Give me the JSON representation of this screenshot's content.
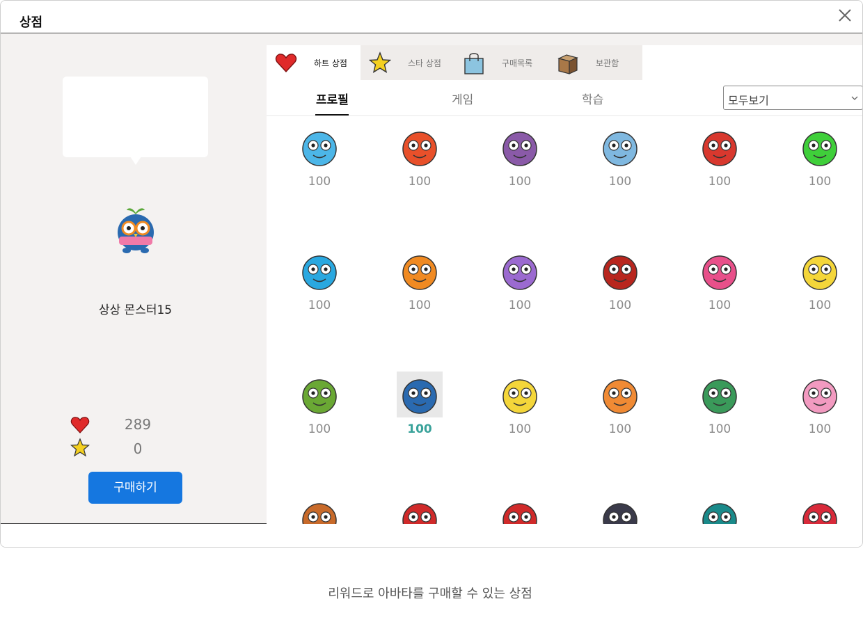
{
  "dialog": {
    "title": "상점"
  },
  "profile": {
    "avatar_name": "상상 몬스터15",
    "hearts": "289",
    "stars": "0",
    "buy_label": "구매하기"
  },
  "tabs": [
    {
      "label": "하트 상점",
      "icon": "heart-icon",
      "active": true
    },
    {
      "label": "스타 상점",
      "icon": "star-icon",
      "active": false
    },
    {
      "label": "구매목록",
      "icon": "shopping-bag-icon",
      "active": false
    },
    {
      "label": "보관함",
      "icon": "box-icon",
      "active": false
    }
  ],
  "subtabs": [
    {
      "label": "프로필",
      "active": true
    },
    {
      "label": "게임",
      "active": false
    },
    {
      "label": "학습",
      "active": false
    }
  ],
  "filter": {
    "value": "모두보기"
  },
  "items": [
    {
      "price": "100",
      "color": "#4cb6e8",
      "name": "blue-flame-monster"
    },
    {
      "price": "100",
      "color": "#e8502a",
      "name": "red-flame-monster"
    },
    {
      "price": "100",
      "color": "#8a5aa8",
      "name": "purple-striped-hat-monster"
    },
    {
      "price": "100",
      "color": "#7fb8e0",
      "name": "astronaut-monster"
    },
    {
      "price": "100",
      "color": "#d8382e",
      "name": "red-robot-monster"
    },
    {
      "price": "100",
      "color": "#3fcf3a",
      "name": "green-alien-monster"
    },
    {
      "price": "100",
      "color": "#2aa8e0",
      "name": "blue-masked-monster"
    },
    {
      "price": "100",
      "color": "#f08a22",
      "name": "orange-sun-king-monster"
    },
    {
      "price": "100",
      "color": "#9b6ad0",
      "name": "purple-cyclops-monster"
    },
    {
      "price": "100",
      "color": "#b8261e",
      "name": "red-many-eyes-monster"
    },
    {
      "price": "100",
      "color": "#e8508a",
      "name": "pink-spiked-monster"
    },
    {
      "price": "100",
      "color": "#f4d63a",
      "name": "yellow-star-monster"
    },
    {
      "price": "100",
      "color": "#6aa834",
      "name": "green-frog-monster"
    },
    {
      "price": "100",
      "color": "#2a6ab0",
      "name": "blue-goggle-sprout-monster",
      "selected": true
    },
    {
      "price": "100",
      "color": "#f4d63a",
      "name": "yellow-cat-monster"
    },
    {
      "price": "100",
      "color": "#f08a34",
      "name": "orange-crab-monster"
    },
    {
      "price": "100",
      "color": "#3a9a5a",
      "name": "green-whale-monster"
    },
    {
      "price": "100",
      "color": "#f29ac0",
      "name": "pink-pig-monster"
    },
    {
      "price": "",
      "color": "#c86a2a",
      "name": "brown-antenna-monster"
    },
    {
      "price": "",
      "color": "#d02a2a",
      "name": "red-crab-monster"
    },
    {
      "price": "",
      "color": "#d02a2a",
      "name": "red-virus-monster"
    },
    {
      "price": "",
      "color": "#3a3a4a",
      "name": "black-bug-monster"
    },
    {
      "price": "",
      "color": "#1a8a8a",
      "name": "teal-dog-monster"
    },
    {
      "price": "",
      "color": "#d82a3a",
      "name": "red-heart-cap-monster"
    }
  ],
  "caption": "리워드로 아바타를 구매할 수 있는 상점"
}
